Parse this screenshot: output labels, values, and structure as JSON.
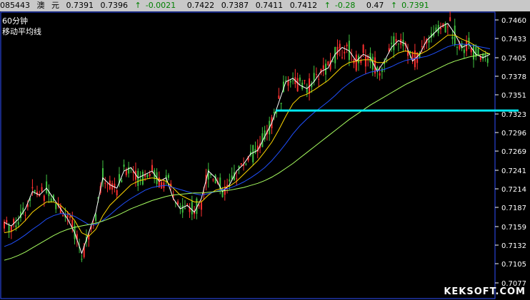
{
  "header": {
    "code": "085443",
    "name": "澳",
    "unit": "元",
    "price1": "0.7391",
    "price2": "0.7396",
    "change": "-0.0021",
    "high": "0.7422",
    "low": "0.7387",
    "v3": "0.7411",
    "v4": "0.7412",
    "pct": "-0.28",
    "v5": "0.47",
    "last": "0.7391",
    "arrow": "↑"
  },
  "chart_labels": {
    "period": "60分钟",
    "indicator": "移动平均线"
  },
  "watermark": "KEKSOFT.COM",
  "colors": {
    "background": "#000000",
    "candle_up": "#ff3030",
    "candle_alt": "#40c040",
    "ma_short": "#ffffff",
    "ma_mid": "#ffd700",
    "ma_long": "#2050ff",
    "ma_longest": "#a8ff60",
    "support_line": "#00e8f0"
  },
  "chart_data": {
    "type": "line",
    "y_tick_labels": [
      "0.7460",
      "0.7433",
      "0.7405",
      "0.7378",
      "0.7351",
      "0.7323",
      "0.7296",
      "0.7269",
      "0.7241",
      "0.7214",
      "0.7187",
      "0.7159",
      "0.7132",
      "0.7105",
      "0.7077"
    ],
    "ylim": [
      0.7077,
      0.746
    ],
    "support_level": 0.7328,
    "x": [
      0,
      10,
      20,
      30,
      40,
      50,
      60,
      70,
      80,
      90,
      100,
      110,
      120,
      130,
      140,
      150,
      160,
      170,
      180,
      190,
      200,
      210,
      220,
      230,
      240,
      250,
      260,
      270,
      280,
      290,
      300,
      310,
      320,
      330,
      340,
      350,
      360,
      370,
      380,
      390,
      400,
      410,
      420,
      430,
      440,
      450,
      460,
      470,
      480,
      490,
      500,
      510,
      520,
      530,
      540,
      550,
      560,
      570,
      580,
      590,
      600,
      610,
      620,
      630,
      640,
      650,
      660,
      670,
      680,
      690
    ],
    "series": [
      {
        "values": [
          0.7165,
          0.716,
          0.717,
          0.7185,
          0.721,
          0.7205,
          0.7215,
          0.72,
          0.7185,
          0.717,
          0.715,
          0.712,
          0.715,
          0.718,
          0.723,
          0.722,
          0.7215,
          0.724,
          0.7245,
          0.723,
          0.7235,
          0.724,
          0.7225,
          0.723,
          0.72,
          0.7185,
          0.719,
          0.718,
          0.72,
          0.724,
          0.723,
          0.721,
          0.722,
          0.724,
          0.725,
          0.7265,
          0.727,
          0.729,
          0.731,
          0.734,
          0.737,
          0.7375,
          0.7365,
          0.736,
          0.737,
          0.7385,
          0.739,
          0.741,
          0.742,
          0.7415,
          0.74,
          0.741,
          0.7405,
          0.7385,
          0.74,
          0.742,
          0.743,
          0.7425,
          0.74,
          0.741,
          0.743,
          0.744,
          0.745,
          0.7455,
          0.744,
          0.742,
          0.7425,
          0.741,
          0.7405,
          0.741
        ]
      },
      {
        "values": [
          0.715,
          0.7152,
          0.7158,
          0.7168,
          0.718,
          0.7188,
          0.7195,
          0.7195,
          0.719,
          0.718,
          0.7168,
          0.715,
          0.7145,
          0.7155,
          0.7175,
          0.719,
          0.72,
          0.721,
          0.722,
          0.7225,
          0.7228,
          0.723,
          0.7228,
          0.7225,
          0.7215,
          0.7205,
          0.72,
          0.7195,
          0.7195,
          0.7205,
          0.7212,
          0.7215,
          0.7218,
          0.7225,
          0.7235,
          0.7245,
          0.7255,
          0.7268,
          0.7282,
          0.73,
          0.732,
          0.7338,
          0.7348,
          0.7352,
          0.7358,
          0.7365,
          0.7372,
          0.7382,
          0.7392,
          0.7398,
          0.74,
          0.7402,
          0.7402,
          0.7398,
          0.7398,
          0.7405,
          0.7412,
          0.7415,
          0.7412,
          0.741,
          0.7415,
          0.7422,
          0.743,
          0.7438,
          0.7438,
          0.7432,
          0.7428,
          0.7422,
          0.7415,
          0.741
        ]
      },
      {
        "values": [
          0.713,
          0.7134,
          0.714,
          0.7147,
          0.7155,
          0.7162,
          0.717,
          0.7175,
          0.7178,
          0.7177,
          0.7174,
          0.7168,
          0.7162,
          0.7162,
          0.7168,
          0.7176,
          0.7185,
          0.7193,
          0.72,
          0.7206,
          0.7212,
          0.7216,
          0.7218,
          0.7219,
          0.7216,
          0.7213,
          0.721,
          0.7207,
          0.7205,
          0.7207,
          0.721,
          0.7213,
          0.7215,
          0.7219,
          0.7224,
          0.723,
          0.7237,
          0.7245,
          0.7255,
          0.7267,
          0.728,
          0.7294,
          0.7306,
          0.7316,
          0.7325,
          0.7333,
          0.7341,
          0.735,
          0.736,
          0.7368,
          0.7375,
          0.738,
          0.7384,
          0.7386,
          0.7388,
          0.7392,
          0.7397,
          0.7401,
          0.7403,
          0.7405,
          0.7407,
          0.7411,
          0.7416,
          0.7421,
          0.7424,
          0.7425,
          0.7424,
          0.7422,
          0.742,
          0.7418
        ]
      },
      {
        "values": [
          0.711,
          0.7113,
          0.7117,
          0.7122,
          0.7128,
          0.7134,
          0.714,
          0.7146,
          0.7151,
          0.7155,
          0.7158,
          0.716,
          0.7162,
          0.7164,
          0.7167,
          0.7171,
          0.7175,
          0.718,
          0.7185,
          0.7189,
          0.7193,
          0.7197,
          0.72,
          0.7203,
          0.7205,
          0.7206,
          0.7207,
          0.7208,
          0.7208,
          0.7209,
          0.721,
          0.7211,
          0.7212,
          0.7214,
          0.7216,
          0.7219,
          0.7222,
          0.7226,
          0.7231,
          0.7237,
          0.7244,
          0.7251,
          0.7259,
          0.7267,
          0.7275,
          0.7283,
          0.7291,
          0.7299,
          0.7307,
          0.7315,
          0.7322,
          0.7329,
          0.7336,
          0.7342,
          0.7348,
          0.7354,
          0.736,
          0.7366,
          0.7371,
          0.7376,
          0.7381,
          0.7386,
          0.7391,
          0.7396,
          0.74,
          0.7403,
          0.7406,
          0.7408,
          0.741,
          0.7411
        ]
      }
    ]
  }
}
